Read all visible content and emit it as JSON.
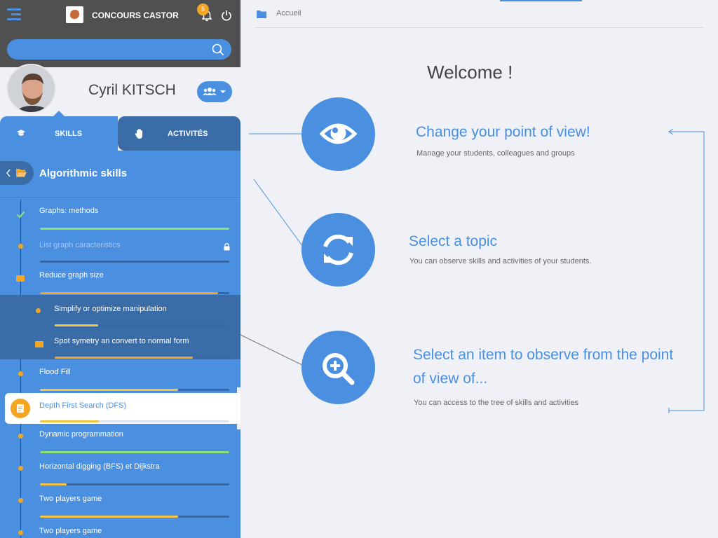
{
  "header": {
    "app_title": "CONCOURS CASTOR",
    "notification_count": "5"
  },
  "search": {
    "placeholder": "",
    "value": ""
  },
  "profile": {
    "name": "Cyril KITSCH"
  },
  "tabs": [
    {
      "label": "SKILLS",
      "icon": "graduation-cap-icon"
    },
    {
      "label": "ACTIVITÉS",
      "icon": "hand-icon"
    }
  ],
  "tree": {
    "title": "Algorithmic skills",
    "items": [
      {
        "label": "Graphs: methods",
        "progress": 1.0,
        "color": "#8ee07a",
        "icon": "check-icon"
      },
      {
        "label": "List graph caracteristics",
        "progress": 0.0,
        "color": "#f4a623",
        "icon": "lock-icon"
      },
      {
        "label": "Reduce graph size",
        "progress": 0.94,
        "color": "#f4a623",
        "icon": "folder-open-icon"
      },
      {
        "label": "Simplify or optimize manipulation",
        "progress": 0.25,
        "color": "#f4c542",
        "icon": "dot-icon"
      },
      {
        "label": "Spot symetry an convert to normal form",
        "progress": 0.79,
        "color": "#f4a623",
        "icon": "folder-open-icon"
      },
      {
        "label": "Flood Fill",
        "progress": 0.73,
        "color": "#f4c542",
        "icon": "dot-icon"
      },
      {
        "label": "Depth First Search (DFS)",
        "progress": 0.31,
        "color": "#f4c542",
        "icon": "document-icon"
      },
      {
        "label": "Dynamic programmation",
        "progress": 1.0,
        "color": "#8ee07a",
        "icon": "dot-icon"
      },
      {
        "label": "Horizontal digging (BFS) et Dijkstra",
        "progress": 0.14,
        "color": "#f4c542",
        "icon": "dot-icon"
      },
      {
        "label": "Two players game",
        "progress": 0.73,
        "color": "#f4c542",
        "icon": "dot-icon"
      },
      {
        "label": "Two players game",
        "progress": 0.0,
        "color": "#f4c542",
        "icon": "dot-icon"
      }
    ]
  },
  "main": {
    "breadcrumb": "Accueil",
    "welcome": "Welcome !",
    "features": [
      {
        "title": "Change your point of view!",
        "desc": "Manage your students, colleagues and groups",
        "icon": "eye-icon"
      },
      {
        "title": "Select a topic",
        "desc": "You can observe skills and activities of your students.",
        "icon": "refresh-icon"
      },
      {
        "title_line1": "Select an item to observe from the point",
        "title_line2": "of view of...",
        "desc": "You can access to the tree of skills and activities",
        "icon": "zoom-in-icon"
      }
    ]
  },
  "colors": {
    "accent": "#4a8fe0",
    "accent_dark": "#3a6ca8",
    "warning": "#f4a623",
    "success": "#8ee07a",
    "header_bg": "#505050",
    "page_bg": "#f0f1f7"
  }
}
